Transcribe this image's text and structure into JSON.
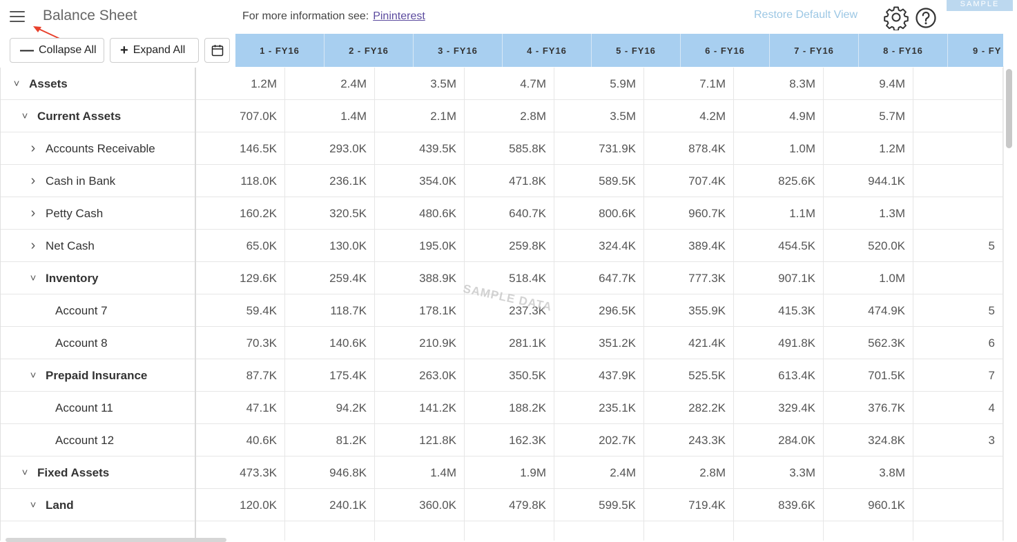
{
  "header": {
    "title": "Balance Sheet",
    "info_prefix": "For more information see:",
    "info_link": "Pininterest",
    "restore_label": "Restore Default View",
    "sample_badge": "SAMPLE"
  },
  "toolbar": {
    "collapse_label": "Collapse All",
    "expand_label": "Expand All"
  },
  "columns": [
    "1 - FY16",
    "2 - FY16",
    "3 - FY16",
    "4 - FY16",
    "5 - FY16",
    "6 - FY16",
    "7 - FY16",
    "8 - FY16",
    "9 - FY"
  ],
  "watermark": "SAMPLE DATA",
  "rows": [
    {
      "label": "Assets",
      "level": 0,
      "toggle": "expanded",
      "bold": true,
      "values": [
        "1.2M",
        "2.4M",
        "3.5M",
        "4.7M",
        "5.9M",
        "7.1M",
        "8.3M",
        "9.4M",
        ""
      ]
    },
    {
      "label": "Current Assets",
      "level": 1,
      "toggle": "expanded",
      "bold": true,
      "values": [
        "707.0K",
        "1.4M",
        "2.1M",
        "2.8M",
        "3.5M",
        "4.2M",
        "4.9M",
        "5.7M",
        ""
      ]
    },
    {
      "label": "Accounts Receivable",
      "level": 2,
      "toggle": "collapsed",
      "bold": false,
      "values": [
        "146.5K",
        "293.0K",
        "439.5K",
        "585.8K",
        "731.9K",
        "878.4K",
        "1.0M",
        "1.2M",
        ""
      ]
    },
    {
      "label": "Cash in Bank",
      "level": 2,
      "toggle": "collapsed",
      "bold": false,
      "values": [
        "118.0K",
        "236.1K",
        "354.0K",
        "471.8K",
        "589.5K",
        "707.4K",
        "825.6K",
        "944.1K",
        ""
      ]
    },
    {
      "label": "Petty Cash",
      "level": 2,
      "toggle": "collapsed",
      "bold": false,
      "values": [
        "160.2K",
        "320.5K",
        "480.6K",
        "640.7K",
        "800.6K",
        "960.7K",
        "1.1M",
        "1.3M",
        ""
      ]
    },
    {
      "label": "Net Cash",
      "level": 2,
      "toggle": "collapsed",
      "bold": false,
      "values": [
        "65.0K",
        "130.0K",
        "195.0K",
        "259.8K",
        "324.4K",
        "389.4K",
        "454.5K",
        "520.0K",
        "5"
      ]
    },
    {
      "label": "Inventory",
      "level": 2,
      "toggle": "expanded",
      "bold": true,
      "values": [
        "129.6K",
        "259.4K",
        "388.9K",
        "518.4K",
        "647.7K",
        "777.3K",
        "907.1K",
        "1.0M",
        ""
      ]
    },
    {
      "label": "Account 7",
      "level": 3,
      "toggle": "none",
      "bold": false,
      "values": [
        "59.4K",
        "118.7K",
        "178.1K",
        "237.3K",
        "296.5K",
        "355.9K",
        "415.3K",
        "474.9K",
        "5"
      ]
    },
    {
      "label": "Account 8",
      "level": 3,
      "toggle": "none",
      "bold": false,
      "values": [
        "70.3K",
        "140.6K",
        "210.9K",
        "281.1K",
        "351.2K",
        "421.4K",
        "491.8K",
        "562.3K",
        "6"
      ]
    },
    {
      "label": "Prepaid Insurance",
      "level": 2,
      "toggle": "expanded",
      "bold": true,
      "values": [
        "87.7K",
        "175.4K",
        "263.0K",
        "350.5K",
        "437.9K",
        "525.5K",
        "613.4K",
        "701.5K",
        "7"
      ]
    },
    {
      "label": "Account 11",
      "level": 3,
      "toggle": "none",
      "bold": false,
      "values": [
        "47.1K",
        "94.2K",
        "141.2K",
        "188.2K",
        "235.1K",
        "282.2K",
        "329.4K",
        "376.7K",
        "4"
      ]
    },
    {
      "label": "Account 12",
      "level": 3,
      "toggle": "none",
      "bold": false,
      "values": [
        "40.6K",
        "81.2K",
        "121.8K",
        "162.3K",
        "202.7K",
        "243.3K",
        "284.0K",
        "324.8K",
        "3"
      ]
    },
    {
      "label": "Fixed Assets",
      "level": 1,
      "toggle": "expanded",
      "bold": true,
      "values": [
        "473.3K",
        "946.8K",
        "1.4M",
        "1.9M",
        "2.4M",
        "2.8M",
        "3.3M",
        "3.8M",
        ""
      ]
    },
    {
      "label": "Land",
      "level": 2,
      "toggle": "expanded",
      "bold": true,
      "values": [
        "120.0K",
        "240.1K",
        "360.0K",
        "479.8K",
        "599.5K",
        "719.4K",
        "839.6K",
        "960.1K",
        ""
      ]
    },
    {
      "label": "",
      "level": 3,
      "toggle": "none",
      "bold": false,
      "values": [
        "",
        "",
        "",
        "",
        "",
        "",
        "",
        "",
        ""
      ]
    }
  ],
  "colors": {
    "header_bg": "#a8cff0",
    "restore_link": "#9cc7e4",
    "info_link": "#5b4a9e",
    "annotation_arrow": "#e8402c"
  }
}
